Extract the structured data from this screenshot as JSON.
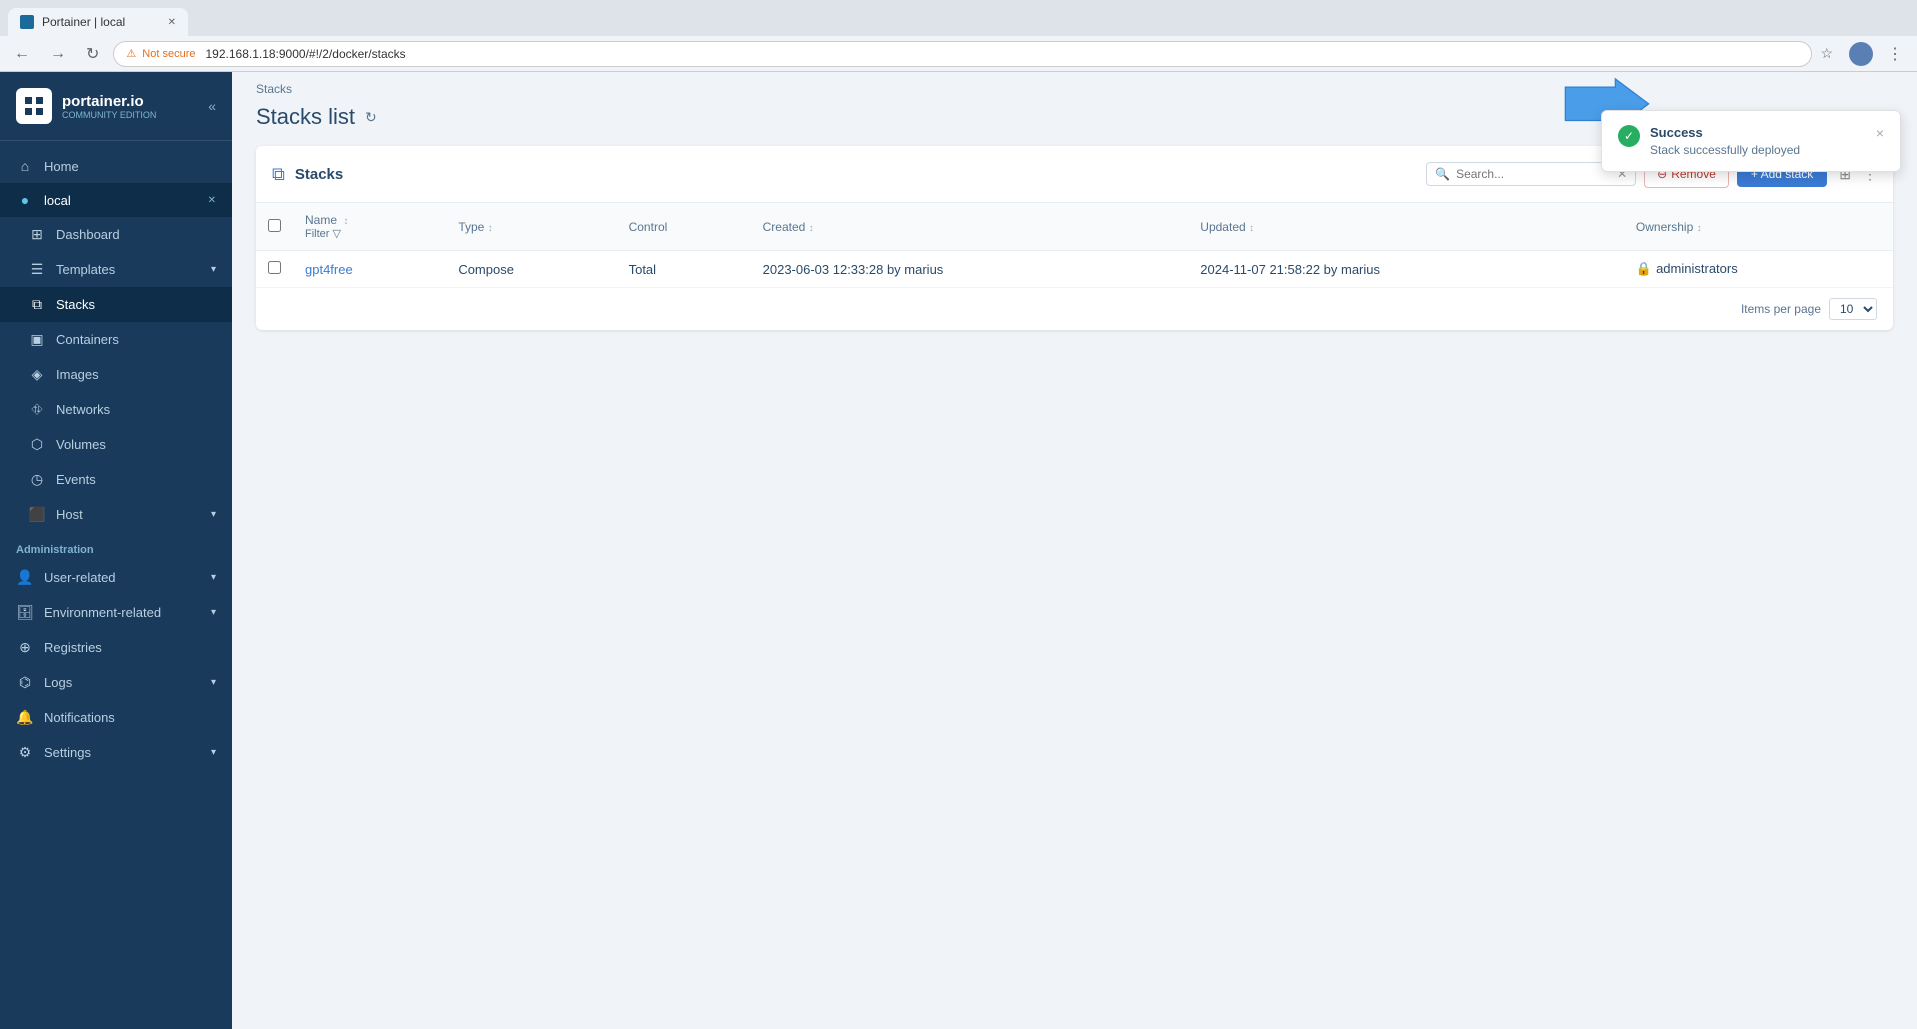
{
  "browser": {
    "tab_title": "Portainer | local",
    "url": "192.168.1.18:9000/#!/2/docker/stacks",
    "not_secure_label": "Not secure"
  },
  "sidebar": {
    "logo_main": "portainer.io",
    "logo_sub": "COMMUNITY EDITION",
    "home_label": "Home",
    "local_label": "local",
    "dashboard_label": "Dashboard",
    "templates_label": "Templates",
    "stacks_label": "Stacks",
    "containers_label": "Containers",
    "images_label": "Images",
    "networks_label": "Networks",
    "volumes_label": "Volumes",
    "events_label": "Events",
    "host_label": "Host",
    "administration_label": "Administration",
    "user_related_label": "User-related",
    "env_related_label": "Environment-related",
    "registries_label": "Registries",
    "logs_label": "Logs",
    "notifications_label": "Notifications",
    "settings_label": "Settings"
  },
  "main": {
    "breadcrumb": "Stacks",
    "page_title": "Stacks list"
  },
  "stacks_panel": {
    "title": "Stacks",
    "search_placeholder": "Search...",
    "remove_label": "Remove",
    "add_stack_label": "+ Add stack",
    "items_per_page_label": "Items per page",
    "items_per_page_value": "10",
    "columns": {
      "name": "Name",
      "type": "Type",
      "control": "Control",
      "created": "Created",
      "updated": "Updated",
      "ownership": "Ownership"
    },
    "rows": [
      {
        "name": "gpt4free",
        "type": "Compose",
        "control": "Total",
        "created": "2023-06-03 12:33:28 by marius",
        "updated": "2024-11-07 21:58:22 by marius",
        "ownership": "administrators"
      }
    ]
  },
  "notification": {
    "title": "Success",
    "message": "Stack successfully deployed",
    "close_label": "×"
  }
}
